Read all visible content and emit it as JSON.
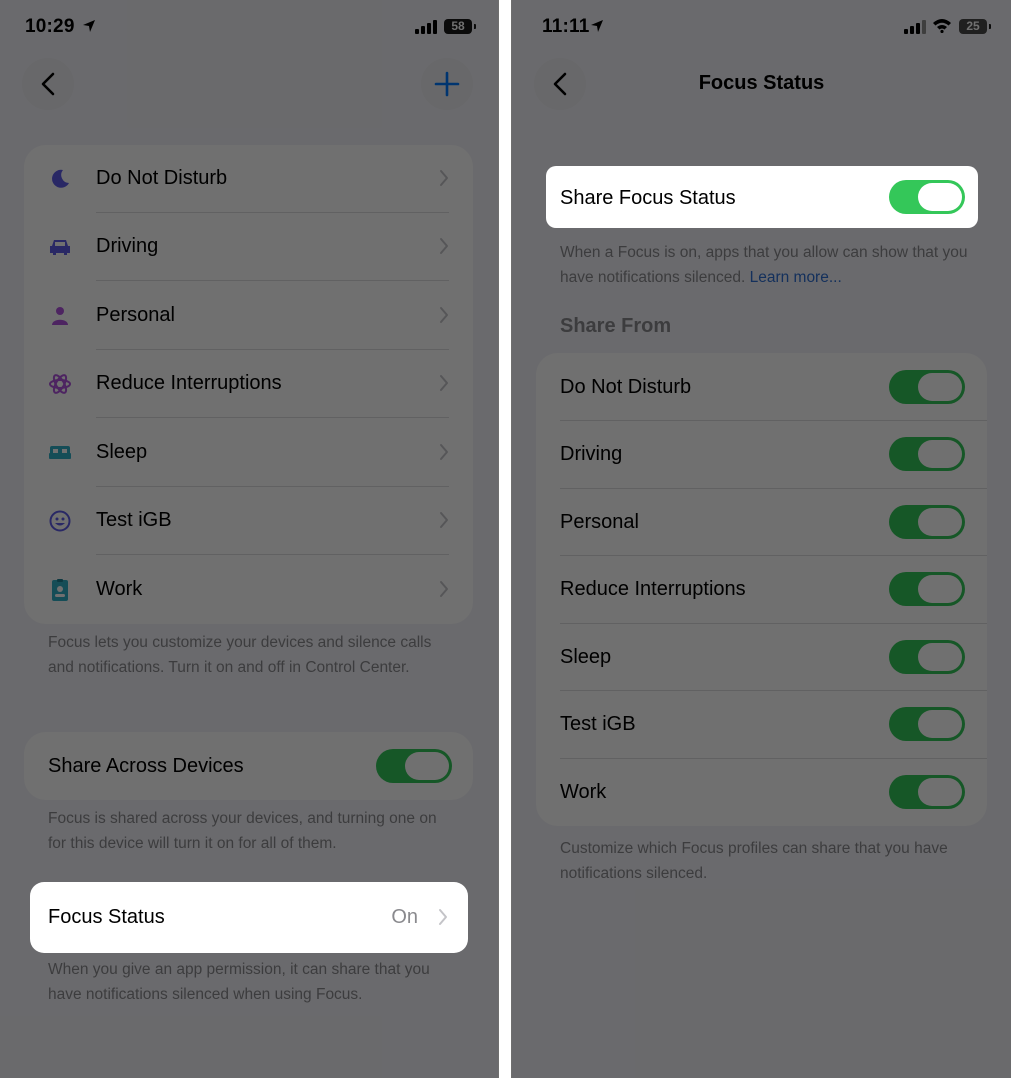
{
  "left": {
    "status": {
      "time": "10:29",
      "battery": "58"
    },
    "focus_modes": [
      {
        "label": "Do Not Disturb",
        "icon": "moon-icon",
        "color": "#5e5ce6"
      },
      {
        "label": "Driving",
        "icon": "car-icon",
        "color": "#5e5ce6"
      },
      {
        "label": "Personal",
        "icon": "person-icon",
        "color": "#af52de"
      },
      {
        "label": "Reduce Interruptions",
        "icon": "flower-icon",
        "color": "#af52de"
      },
      {
        "label": "Sleep",
        "icon": "bed-icon",
        "color": "#30b0c7"
      },
      {
        "label": "Test iGB",
        "icon": "smiley-icon",
        "color": "#5e5ce6"
      },
      {
        "label": "Work",
        "icon": "badge-icon",
        "color": "#30b0c7"
      }
    ],
    "focus_footnote": "Focus lets you customize your devices and silence calls and notifications. Turn it on and off in Control Center.",
    "share_across": {
      "label": "Share Across Devices",
      "on": true
    },
    "share_across_footnote": "Focus is shared across your devices, and turning one on for this device will turn it on for all of them.",
    "focus_status": {
      "label": "Focus Status",
      "value": "On"
    },
    "focus_status_footnote": "When you give an app permission, it can share that you have notifications silenced when using Focus."
  },
  "right": {
    "status": {
      "time": "11:11",
      "battery": "25"
    },
    "title": "Focus Status",
    "share_focus_status": {
      "label": "Share Focus Status",
      "on": true
    },
    "share_footnote": "When a Focus is on, apps that you allow can show that you have notifications silenced.",
    "learn_more": "Learn more...",
    "share_from_header": "Share From",
    "share_from": [
      {
        "label": "Do Not Disturb",
        "on": true
      },
      {
        "label": "Driving",
        "on": true
      },
      {
        "label": "Personal",
        "on": true
      },
      {
        "label": "Reduce Interruptions",
        "on": true
      },
      {
        "label": "Sleep",
        "on": true
      },
      {
        "label": "Test iGB",
        "on": true
      },
      {
        "label": "Work",
        "on": true
      }
    ],
    "share_from_footnote": "Customize which Focus profiles can share that you have notifications silenced."
  },
  "colors": {
    "toggle_on": "#34c759",
    "accent": "#007aff",
    "link": "#2f6fd1"
  }
}
